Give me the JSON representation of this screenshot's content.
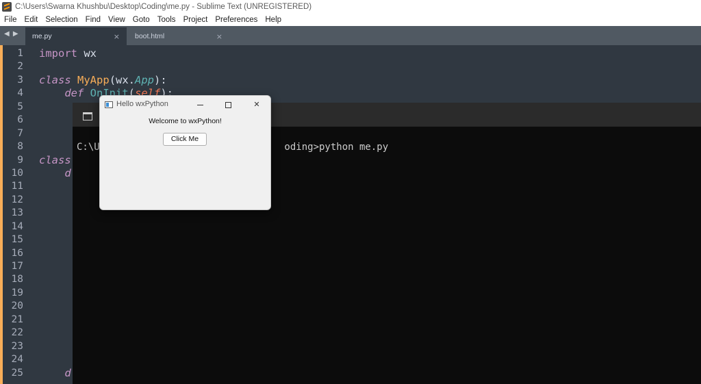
{
  "window": {
    "title": "C:\\Users\\Swarna Khushbu\\Desktop\\Coding\\me.py - Sublime Text (UNREGISTERED)"
  },
  "menu": [
    "File",
    "Edit",
    "Selection",
    "Find",
    "View",
    "Goto",
    "Tools",
    "Project",
    "Preferences",
    "Help"
  ],
  "tabs": [
    {
      "label": "me.py",
      "close": "×",
      "active": true
    },
    {
      "label": "boot.html",
      "close": "×",
      "active": false
    }
  ],
  "tab_nav": "◀ ▶",
  "editor": {
    "line_numbers": [
      "1",
      "2",
      "3",
      "4",
      "5",
      "6",
      "7",
      "8",
      "9",
      "10",
      "11",
      "12",
      "13",
      "14",
      "15",
      "16",
      "17",
      "18",
      "19",
      "20",
      "21",
      "22",
      "23",
      "24",
      "25"
    ],
    "code": {
      "l1_kw": "import",
      "l1_rest": " wx",
      "l3_kw": "class",
      "l3_name": "MyApp",
      "l3_open": "(wx.",
      "l3_base": "App",
      "l3_close": "):",
      "l4_indent": "    ",
      "l4_kw": "def",
      "l4_sp": " ",
      "l4_fn": "OnInit",
      "l4_open": "(",
      "l4_param": "self",
      "l4_close": "):",
      "l9_kw": "class",
      "l10_indent": "    ",
      "l10_kw": "d",
      "l25_indent": "    ",
      "l25_kw": "d"
    }
  },
  "terminal": {
    "line": "C:\\U                                oding>python me.py"
  },
  "wx_window": {
    "title": "Hello wxPython",
    "welcome_text": "Welcome to wxPython!",
    "button_label": "Click Me",
    "minimize": "—",
    "close": "✕"
  },
  "colors": {
    "editor_bg": "#303841",
    "keyword": "#c695c6",
    "class_name": "#f9ae58",
    "function": "#5fb4b4",
    "terminal_bg": "#0c0c0c"
  }
}
